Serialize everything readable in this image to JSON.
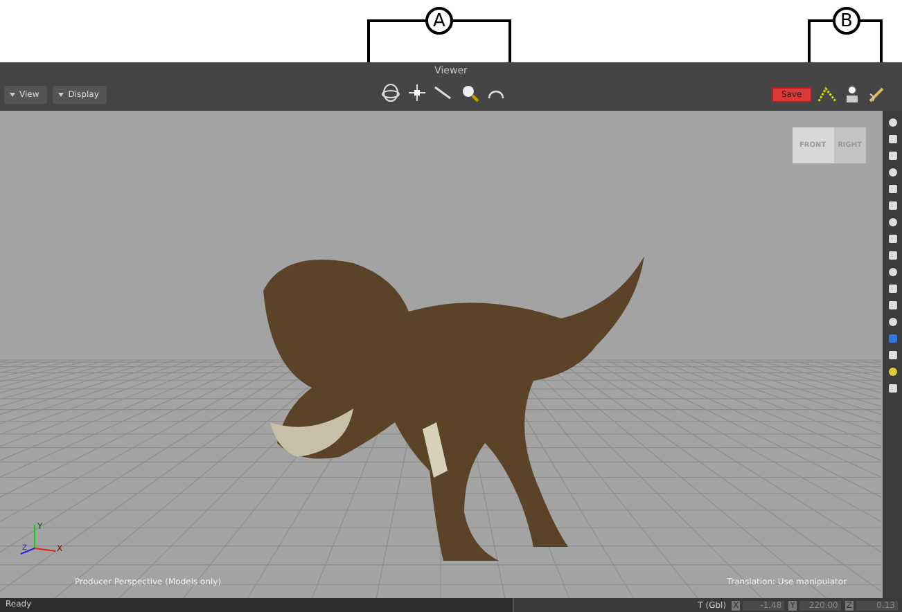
{
  "callouts": [
    {
      "label": "A"
    },
    {
      "label": "B"
    }
  ],
  "toolbar": {
    "title": "Viewer",
    "menus": [
      {
        "label": "View"
      },
      {
        "label": "Display"
      }
    ],
    "save_button": "Save"
  },
  "viewport": {
    "view_cube": {
      "faces": [
        "FRONT",
        "RIGHT"
      ]
    },
    "axes": [
      "X",
      "Y",
      "Z"
    ],
    "camera_label": "Producer Perspective (Models only)",
    "mode_label": "Translation: Use manipulator"
  },
  "status_bar": {
    "message": "Ready",
    "transform_label": "T (Gbl)",
    "coords": [
      {
        "axis": "X",
        "value": "-1.48"
      },
      {
        "axis": "Y",
        "value": "220.00"
      },
      {
        "axis": "Z",
        "value": "0.13"
      }
    ]
  }
}
